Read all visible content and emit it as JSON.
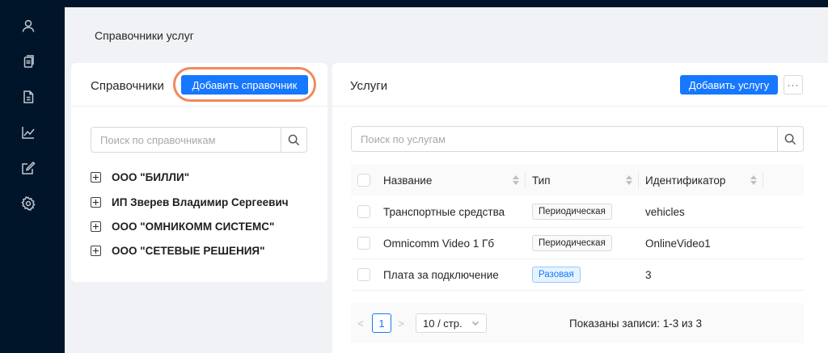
{
  "sidebar": {
    "icons": [
      "user-icon",
      "copy-icon",
      "document-icon",
      "chart-icon",
      "edit-icon",
      "settings-icon"
    ]
  },
  "page": {
    "title": "Справочники услуг"
  },
  "left_panel": {
    "title": "Справочники",
    "add_button": "Добавить справочник",
    "search_placeholder": "Поиск по справочникам",
    "tree_items": [
      {
        "label": "ООО \"БИЛЛИ\""
      },
      {
        "label": "ИП Зверев Владимир Сергеевич"
      },
      {
        "label": "ООО \"ОМНИКОММ СИСТЕМС\""
      },
      {
        "label": "ООО \"СЕТЕВЫЕ РЕШЕНИЯ\""
      }
    ]
  },
  "right_panel": {
    "title": "Услуги",
    "add_button": "Добавить услугу",
    "more_button": "···",
    "search_placeholder": "Поиск по услугам",
    "table": {
      "columns": [
        "Название",
        "Тип",
        "Идентификатор"
      ],
      "rows": [
        {
          "name": "Транспортные средства",
          "type": "Периодическая",
          "type_style": "default",
          "id": "vehicles"
        },
        {
          "name": "Omnicomm Video 1 Гб",
          "type": "Периодическая",
          "type_style": "default",
          "id": "OnlineVideo1"
        },
        {
          "name": "Плата за подключение",
          "type": "Разовая",
          "type_style": "blue",
          "id": "3"
        }
      ]
    },
    "pagination": {
      "prev": "<",
      "current_page": "1",
      "next": ">",
      "page_size": "10 / стр.",
      "info": "Показаны записи: 1-3 из 3"
    }
  },
  "colors": {
    "primary": "#1677ff",
    "sidebar_bg": "#001529",
    "highlight": "#f08a5d"
  }
}
